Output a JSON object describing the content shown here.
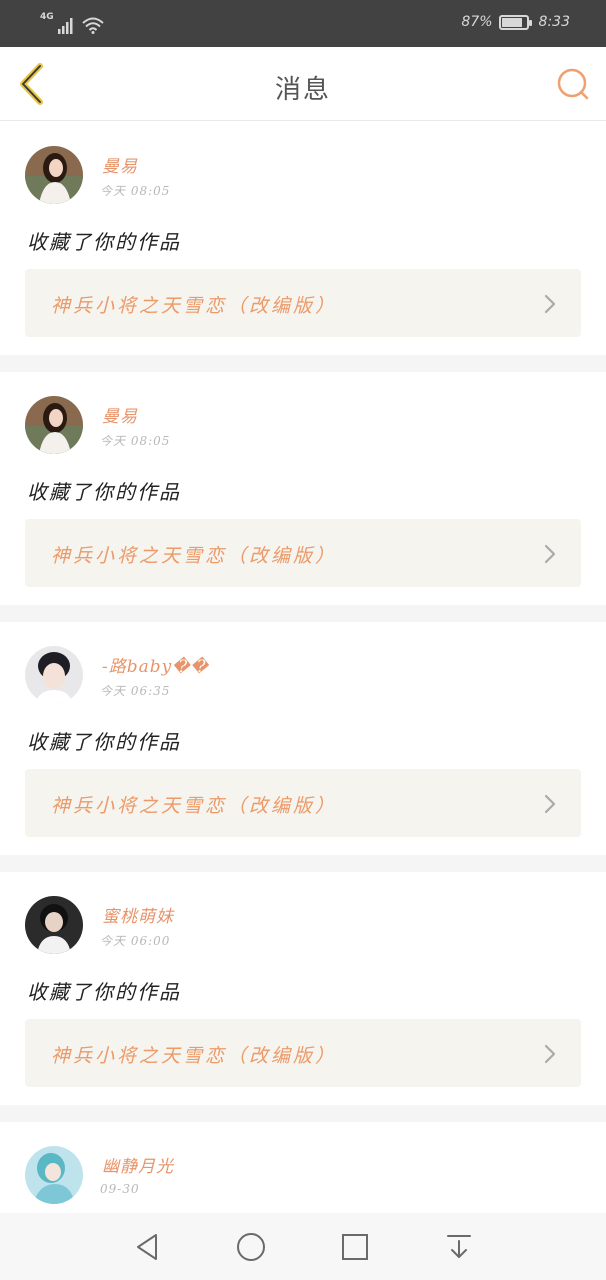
{
  "status_bar": {
    "network": "4G",
    "battery_text": "87%",
    "battery_level": 0.87,
    "time": "8:33"
  },
  "header": {
    "title": "消息",
    "back_icon": "chevron-left-icon",
    "search_icon": "search-icon"
  },
  "colors": {
    "accent": "#ec9a6a",
    "username": "#e8946a",
    "back_icon": "#e8c443",
    "search_icon": "#f0a070",
    "card_link_bg": "#f5f4ee",
    "status_bar_bg": "#424242"
  },
  "messages": [
    {
      "user": "曼易",
      "time": "今天 08:05",
      "action": "收藏了你的作品",
      "work_title": "神兵小将之天雪恋（改编版）"
    },
    {
      "user": "曼易",
      "time": "今天 08:05",
      "action": "收藏了你的作品",
      "work_title": "神兵小将之天雪恋（改编版）"
    },
    {
      "user": "-路baby��",
      "time": "今天 06:35",
      "action": "收藏了你的作品",
      "work_title": "神兵小将之天雪恋（改编版）"
    },
    {
      "user": "蜜桃萌妹",
      "time": "今天 06:00",
      "action": "收藏了你的作品",
      "work_title": "神兵小将之天雪恋（改编版）"
    },
    {
      "user": "幽静月光",
      "time": "09-30"
    }
  ],
  "nav": {
    "back": "triangle-back-icon",
    "home": "circle-home-icon",
    "recents": "square-recents-icon",
    "notifications": "pull-down-icon"
  }
}
